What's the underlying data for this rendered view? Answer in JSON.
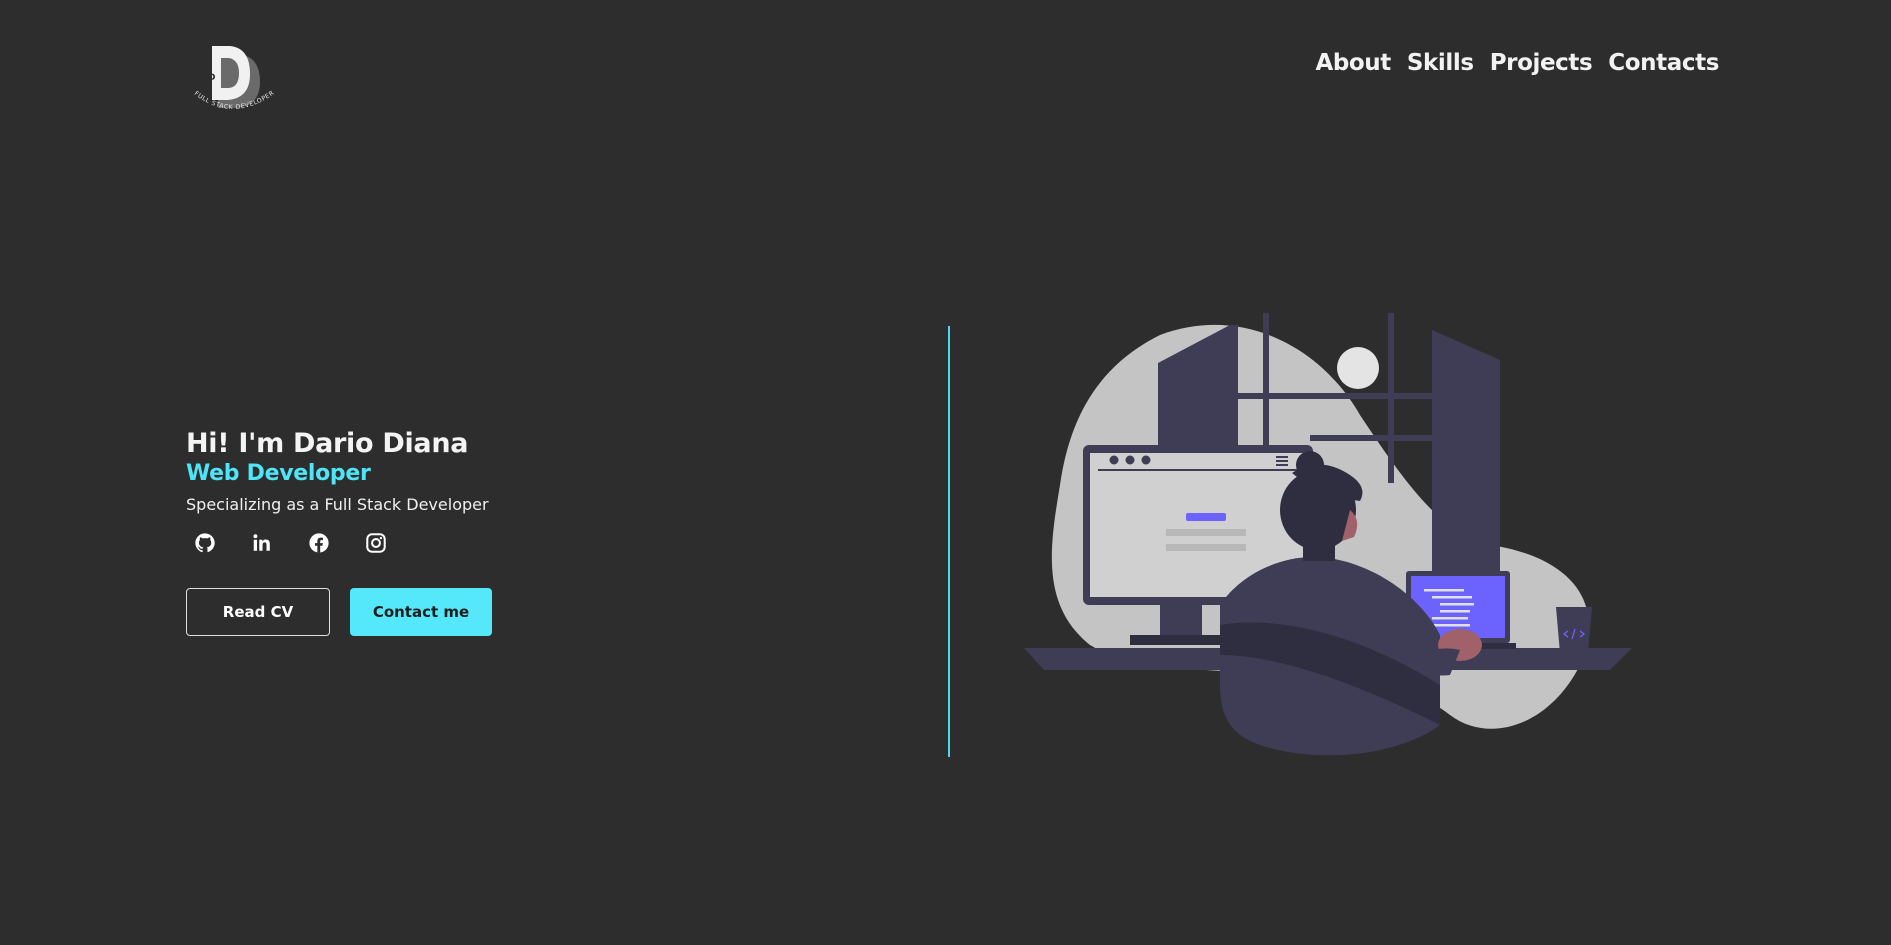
{
  "logo": {
    "letter": "D",
    "tagline": "FULL STACK DEVELOPER"
  },
  "nav": {
    "items": [
      {
        "label": "About"
      },
      {
        "label": "Skills"
      },
      {
        "label": "Projects"
      },
      {
        "label": "Contacts"
      }
    ]
  },
  "hero": {
    "greeting": "Hi! I'm Dario Diana",
    "role": "Web Developer",
    "tagline": "Specializing as a Full Stack Developer"
  },
  "socials": [
    {
      "icon": "github-icon"
    },
    {
      "icon": "linkedin-icon"
    },
    {
      "icon": "facebook-icon"
    },
    {
      "icon": "instagram-icon"
    }
  ],
  "buttons": {
    "read_cv": "Read CV",
    "contact": "Contact me"
  },
  "colors": {
    "background": "#2d2d2d",
    "accent": "#55e8fb",
    "text": "#ffffff",
    "illustration_primary": "#6c63ff"
  }
}
